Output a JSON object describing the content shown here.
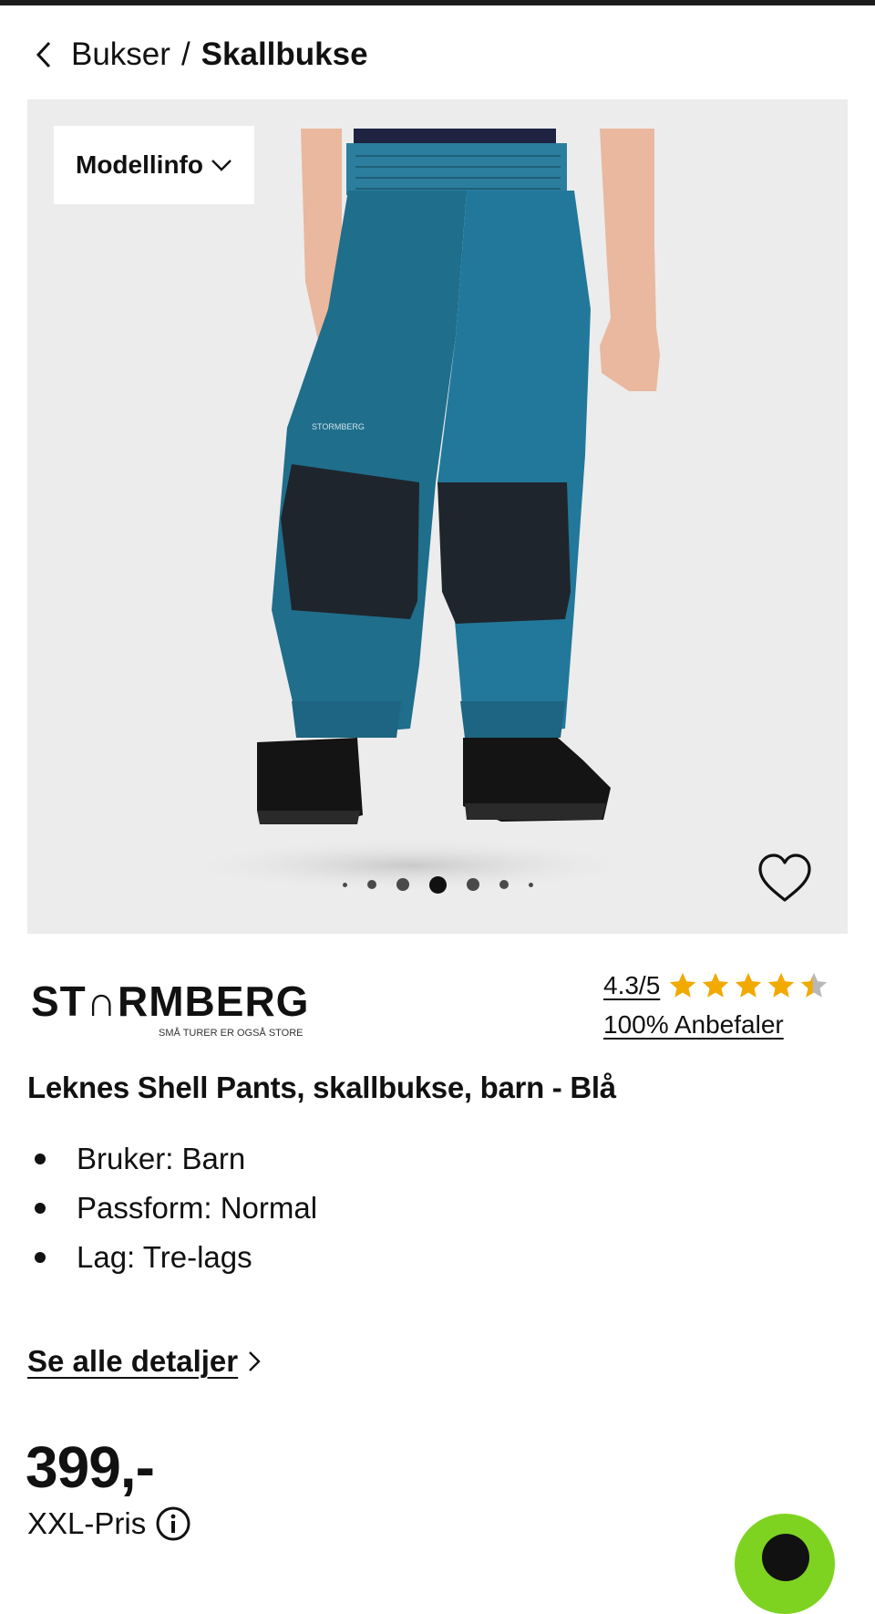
{
  "breadcrumb": {
    "back_icon": "chevron-left-icon",
    "parent": "Bukser",
    "separator": "/",
    "current": "Skallbukse"
  },
  "gallery": {
    "modellinfo_label": "Modellinfo",
    "modellinfo_icon": "chevron-down-icon",
    "image_count": 7,
    "active_index": 3,
    "favorite_icon": "heart-outline-icon",
    "product_logo_text": "STORMBERG"
  },
  "brand": {
    "name": "ST∩RMBERG",
    "tagline": "SMÅ TURER ER OGSÅ STORE"
  },
  "rating": {
    "score_text": "4.3/5",
    "value": 4.3,
    "max": 5,
    "recommend_text": "100% Anbefaler",
    "star_color": "#f2a900"
  },
  "product": {
    "title": "Leknes Shell Pants, skallbukse, barn - Blå",
    "features": [
      "Bruker: Barn",
      "Passform: Normal",
      "Lag: Tre-lags"
    ],
    "details_link": "Se alle detaljer",
    "price": "399,-",
    "xxl_label": "XXL-Pris",
    "info_icon": "info-icon"
  },
  "colors": {
    "chat_button": "#7ed321",
    "pants_blue": "#1f6e8c",
    "patch_dark": "#1f252c"
  }
}
